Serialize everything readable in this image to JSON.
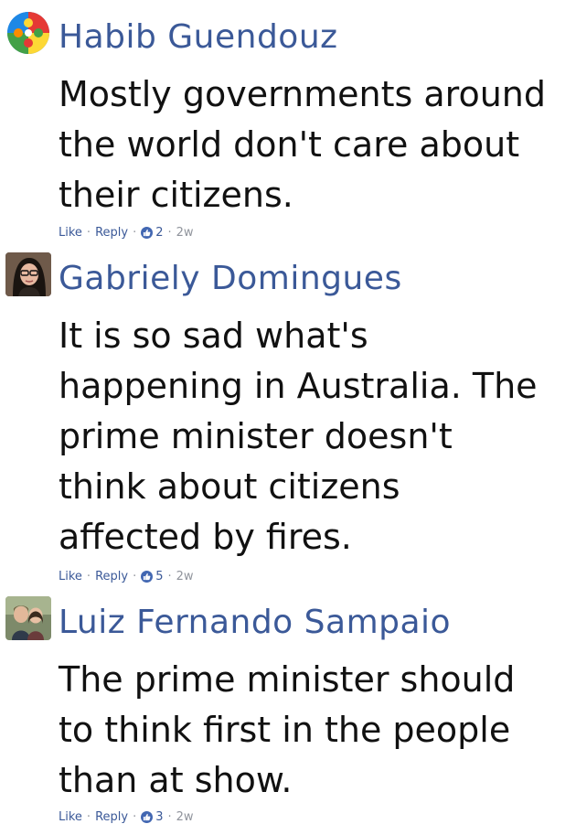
{
  "comments": [
    {
      "author": "Habib Guendouz",
      "avatar": "puzzle-avatar",
      "lines": [
        "Mostly governments around",
        "the world don't care about",
        "their citizens."
      ],
      "like_label": "Like",
      "reply_label": "Reply",
      "reactions": "2",
      "time": "2w"
    },
    {
      "author": "Gabriely Domingues",
      "avatar": "woman-glasses-avatar",
      "lines": [
        "It is so sad what's",
        "happening in Australia. The",
        "prime minister doesn't",
        "think about citizens",
        "affected by fires."
      ],
      "like_label": "Like",
      "reply_label": "Reply",
      "reactions": "5",
      "time": "2w"
    },
    {
      "author": "Luiz Fernando Sampaio",
      "avatar": "couple-avatar",
      "lines": [
        "The prime minister should",
        "to think first in the people",
        "than at show."
      ],
      "like_label": "Like",
      "reply_label": "Reply",
      "reactions": "3",
      "time": "2w"
    }
  ],
  "colors": {
    "author": "#3b5998",
    "text": "#111111",
    "meta": "#90949c",
    "like_badge": "#4267b2"
  }
}
